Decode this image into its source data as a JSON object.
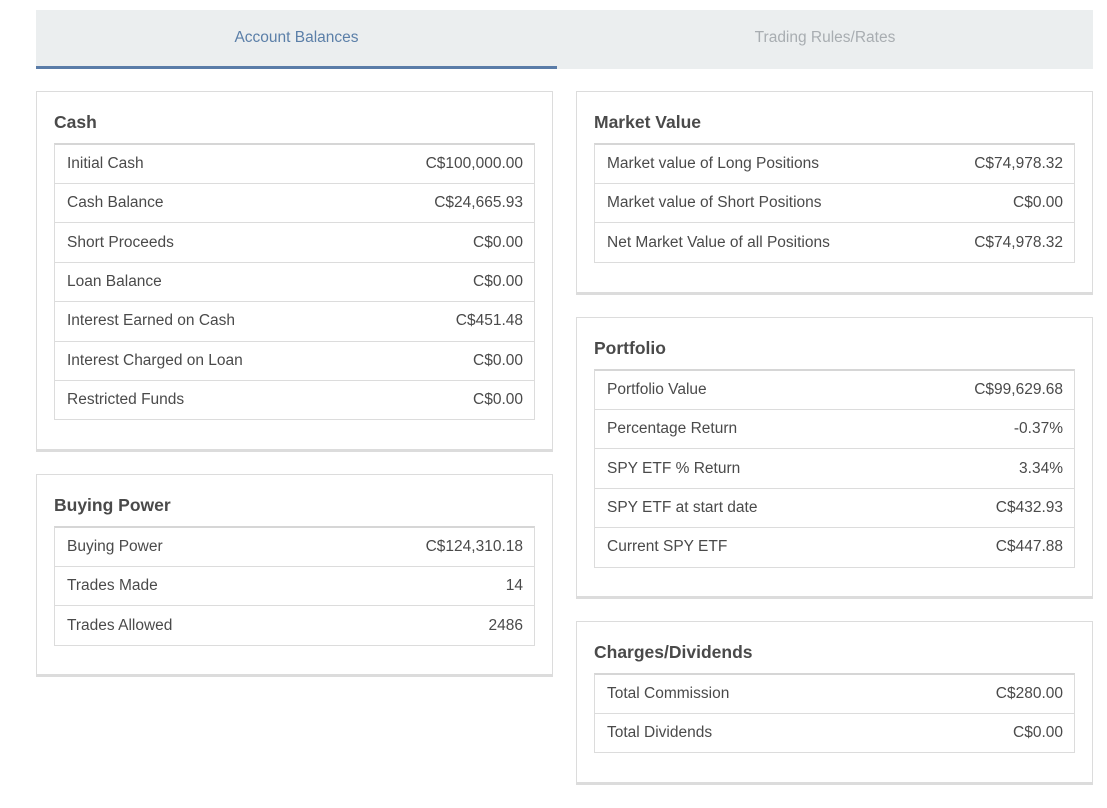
{
  "tabs": [
    {
      "label": "Account Balances",
      "active": true
    },
    {
      "label": "Trading Rules/Rates",
      "active": false
    }
  ],
  "cash": {
    "title": "Cash",
    "rows": [
      {
        "label": "Initial Cash",
        "value": "C$100,000.00"
      },
      {
        "label": "Cash Balance",
        "value": "C$24,665.93"
      },
      {
        "label": "Short Proceeds",
        "value": "C$0.00"
      },
      {
        "label": "Loan Balance",
        "value": "C$0.00"
      },
      {
        "label": "Interest Earned on Cash",
        "value": "C$451.48"
      },
      {
        "label": "Interest Charged on Loan",
        "value": "C$0.00"
      },
      {
        "label": "Restricted Funds",
        "value": "C$0.00"
      }
    ]
  },
  "buying_power": {
    "title": "Buying Power",
    "rows": [
      {
        "label": "Buying Power",
        "value": "C$124,310.18"
      },
      {
        "label": "Trades Made",
        "value": "14"
      },
      {
        "label": "Trades Allowed",
        "value": "2486"
      }
    ]
  },
  "market_value": {
    "title": "Market Value",
    "rows": [
      {
        "label": "Market value of Long Positions",
        "value": "C$74,978.32"
      },
      {
        "label": "Market value of Short Positions",
        "value": "C$0.00"
      },
      {
        "label": "Net Market Value of all Positions",
        "value": "C$74,978.32"
      }
    ]
  },
  "portfolio": {
    "title": "Portfolio",
    "rows": [
      {
        "label": "Portfolio Value",
        "value": "C$99,629.68"
      },
      {
        "label": "Percentage Return",
        "value": "-0.37%"
      },
      {
        "label": "SPY ETF % Return",
        "value": "3.34%"
      },
      {
        "label": "SPY ETF at start date",
        "value": "C$432.93"
      },
      {
        "label": "Current SPY ETF",
        "value": "C$447.88"
      }
    ]
  },
  "charges": {
    "title": "Charges/Dividends",
    "rows": [
      {
        "label": "Total Commission",
        "value": "C$280.00"
      },
      {
        "label": "Total Dividends",
        "value": "C$0.00"
      }
    ]
  }
}
